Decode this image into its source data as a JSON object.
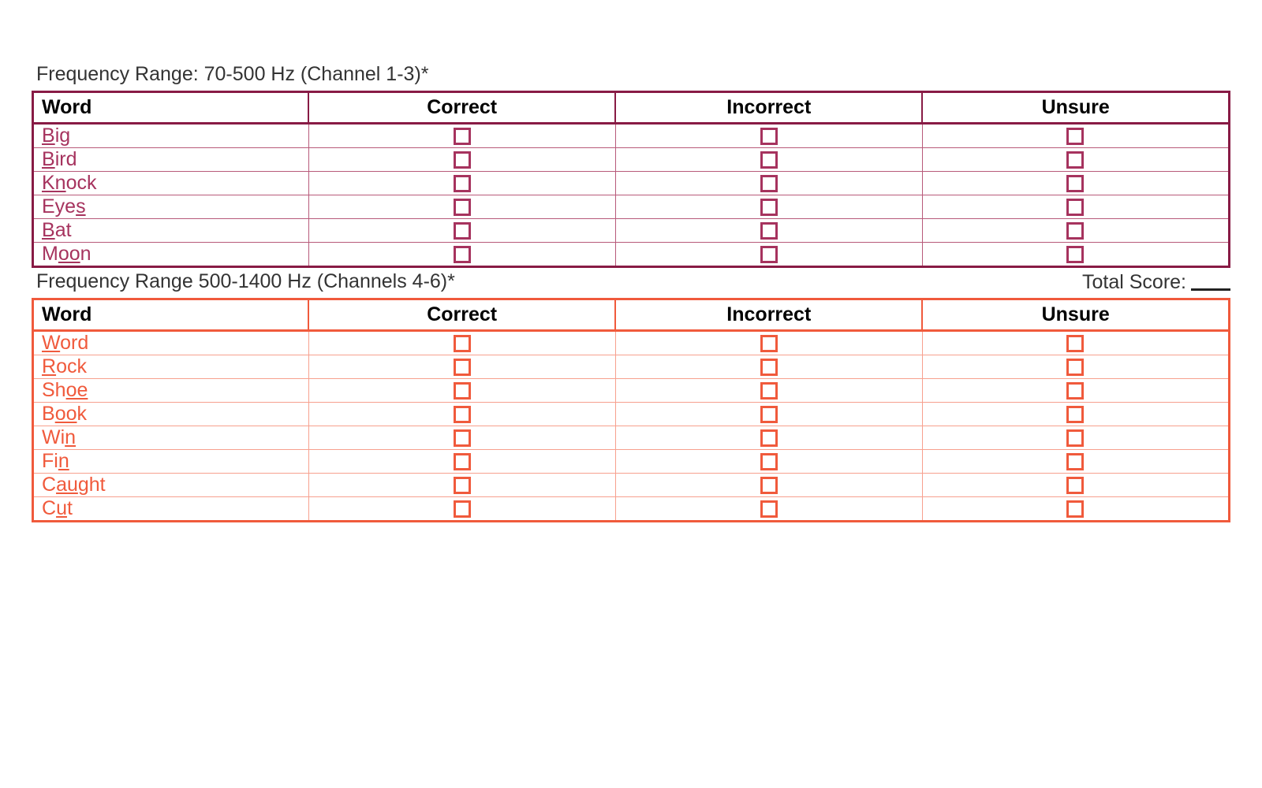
{
  "sections": [
    {
      "title": "Frequency Range: 70-500 Hz (Channel 1-3)*",
      "headers": [
        "Word",
        "Correct",
        "Incorrect",
        "Unsure"
      ],
      "words": [
        {
          "pre": "",
          "u": "B",
          "post": "ig"
        },
        {
          "pre": "",
          "u": "B",
          "post": "ird"
        },
        {
          "pre": "",
          "u": "Kn",
          "post": "ock"
        },
        {
          "pre": "Eye",
          "u": "s",
          "post": ""
        },
        {
          "pre": "",
          "u": "B",
          "post": "at"
        },
        {
          "pre": "M",
          "u": "oo",
          "post": "n"
        }
      ]
    },
    {
      "title": "Frequency Range 500-1400 Hz (Channels 4-6)*",
      "headers": [
        "Word",
        "Correct",
        "Incorrect",
        "Unsure"
      ],
      "words": [
        {
          "pre": "",
          "u": "W",
          "post": "ord"
        },
        {
          "pre": "",
          "u": "R",
          "post": "ock"
        },
        {
          "pre": "Sh",
          "u": "oe",
          "post": ""
        },
        {
          "pre": "B",
          "u": "oo",
          "post": "k"
        },
        {
          "pre": "Wi",
          "u": "n",
          "post": ""
        },
        {
          "pre": "Fi",
          "u": "n",
          "post": ""
        },
        {
          "pre": "C",
          "u": "au",
          "post": "ght"
        },
        {
          "pre": "C",
          "u": "u",
          "post": "t"
        }
      ]
    }
  ],
  "score_label": "Total Score:"
}
